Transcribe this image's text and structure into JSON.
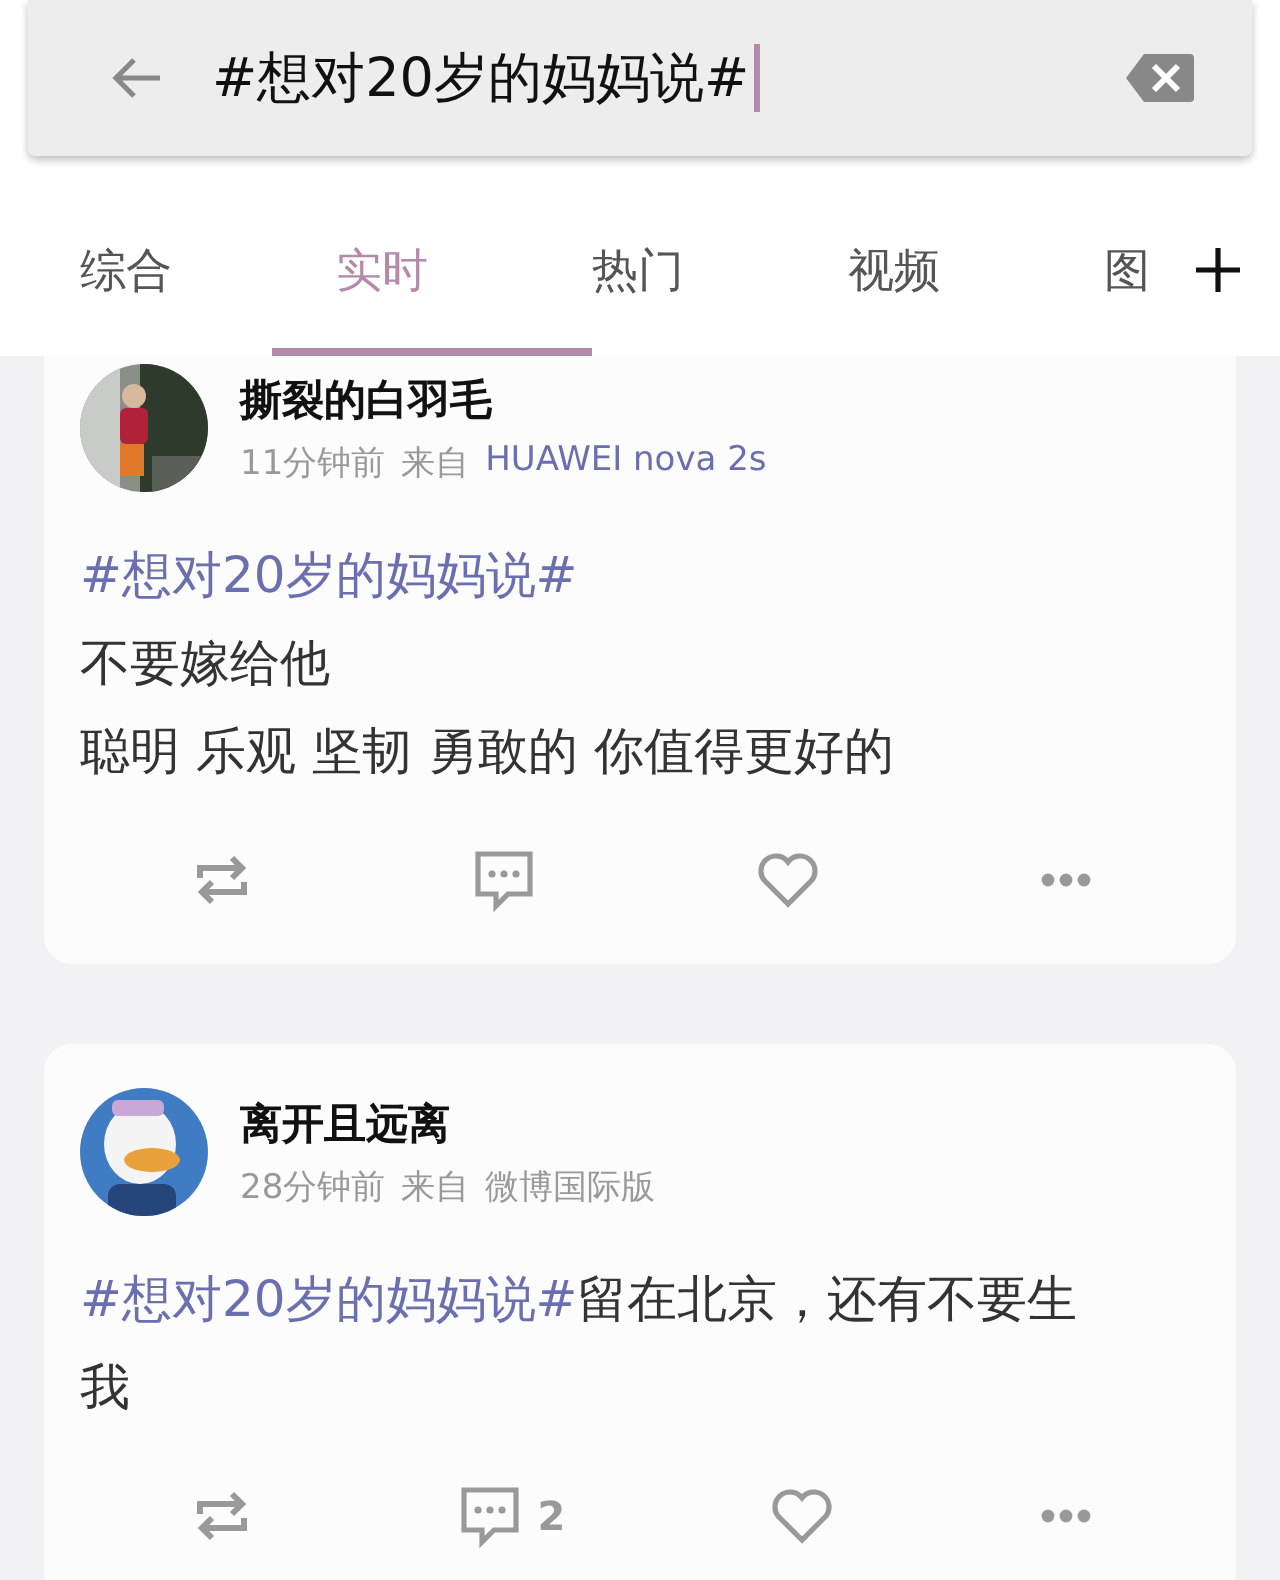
{
  "search": {
    "value": "#想对20岁的妈妈说#"
  },
  "tabs": [
    {
      "label": "综合",
      "selected": false
    },
    {
      "label": "实时",
      "selected": true
    },
    {
      "label": "热门",
      "selected": false
    },
    {
      "label": "视频",
      "selected": false
    },
    {
      "label": "图",
      "selected": false
    }
  ],
  "posts": [
    {
      "avatar": {
        "kind": "picture"
      },
      "author": "撕裂的白羽毛",
      "time": "11分钟前",
      "from_label": "来自",
      "source": "HUAWEI nova 2s",
      "source_link": true,
      "body": [
        [
          {
            "kind": "topic",
            "text": "#想对20岁的妈妈说#"
          }
        ],
        [
          {
            "kind": "plain",
            "text": "不要嫁给他"
          }
        ],
        [
          {
            "kind": "plain",
            "text": "聪明 乐观 坚韧 勇敢的 你值得更好的"
          }
        ]
      ]
    },
    {
      "avatar": {
        "kind": "picture"
      },
      "author": "离开且远离",
      "time": "28分钟前",
      "from_label": "来自",
      "source": "微博国际版",
      "source_link": false,
      "body": [
        [
          {
            "kind": "topic",
            "text": "#想对20岁的妈妈说#"
          },
          {
            "kind": "plain",
            "text": "留在北京，还有不要生我"
          }
        ]
      ],
      "comment_count": "2"
    }
  ]
}
